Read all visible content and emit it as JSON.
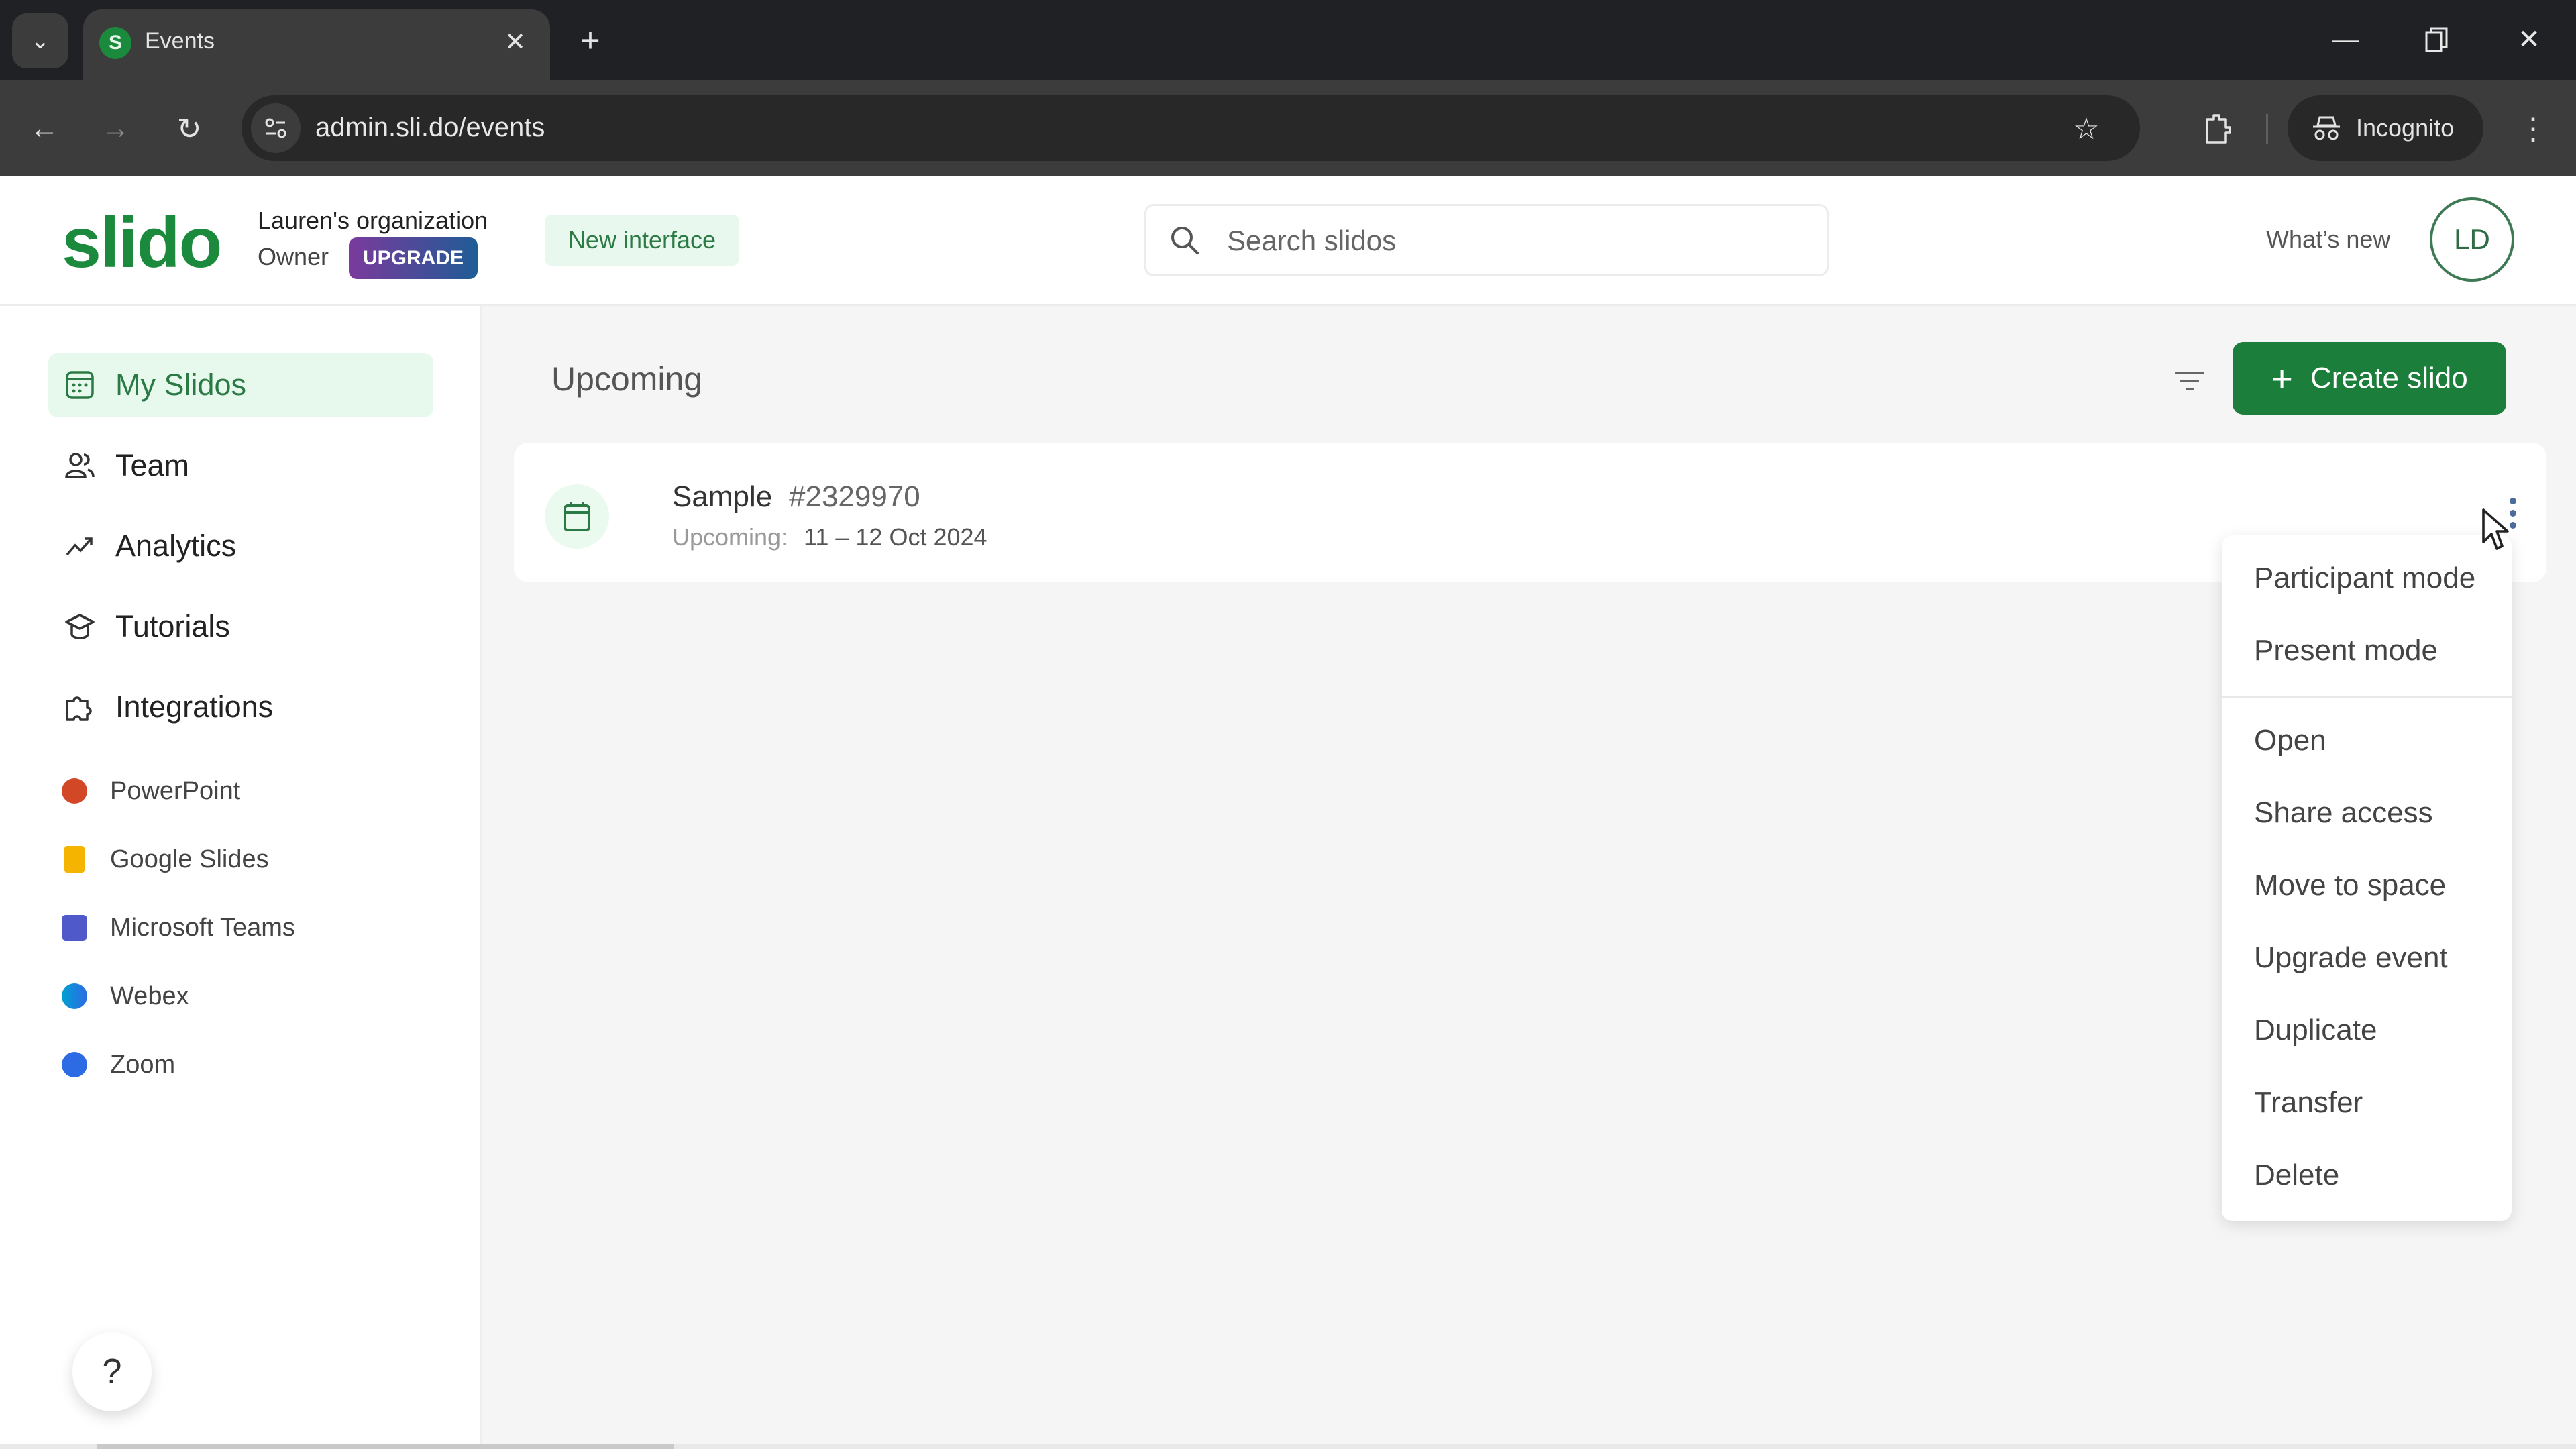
{
  "browser": {
    "tab_title": "Events",
    "tab_favicon_letter": "S",
    "url": "admin.sli.do/events",
    "profile_label": "Incognito",
    "icons": {
      "tab_list": "chevron-down-icon",
      "tab_close": "close-icon",
      "new_tab": "plus-icon",
      "back": "arrow-left-icon",
      "forward": "arrow-right-icon",
      "reload": "reload-icon",
      "site_info": "tune-icon",
      "bookmark": "star-icon",
      "extensions": "puzzle-icon",
      "incognito": "incognito-icon",
      "menu": "kebab-menu-icon",
      "minimize": "minimize-icon",
      "restore": "restore-icon",
      "close": "close-icon"
    }
  },
  "header": {
    "logo": "slido",
    "org_name": "Lauren's organization",
    "role": "Owner",
    "upgrade_label": "UPGRADE",
    "new_interface_label": "New interface",
    "search_placeholder": "Search slidos",
    "whats_new_label": "What’s new",
    "avatar_initials": "LD",
    "colors": {
      "brand": "#1b8a3c",
      "upgrade_from": "#7b3a9c",
      "upgrade_to": "#1f5c95"
    }
  },
  "sidebar": {
    "items": [
      {
        "label": "My Slidos",
        "icon": "calendar-grid-icon",
        "active": true
      },
      {
        "label": "Team",
        "icon": "users-icon",
        "active": false
      },
      {
        "label": "Analytics",
        "icon": "trend-up-icon",
        "active": false
      },
      {
        "label": "Tutorials",
        "icon": "graduation-cap-icon",
        "active": false
      },
      {
        "label": "Integrations",
        "icon": "puzzle-icon",
        "active": false
      }
    ],
    "integrations": [
      {
        "label": "PowerPoint",
        "icon": "powerpoint-icon",
        "color": "#d24726"
      },
      {
        "label": "Google Slides",
        "icon": "google-slides-icon",
        "color": "#f4b400"
      },
      {
        "label": "Microsoft Teams",
        "icon": "microsoft-teams-icon",
        "color": "#5059c9"
      },
      {
        "label": "Webex",
        "icon": "webex-icon",
        "color": "#00a0d1"
      },
      {
        "label": "Zoom",
        "icon": "zoom-icon",
        "color": "#2d6be4"
      }
    ],
    "help_label": "?"
  },
  "main": {
    "section_title": "Upcoming",
    "create_button_label": "Create slido",
    "events": [
      {
        "name": "Sample",
        "code": "#2329970",
        "status_label": "Upcoming:",
        "date_range": "11 – 12 Oct 2024"
      }
    ],
    "context_menu": {
      "items": [
        "Participant mode",
        "Present mode",
        "Open",
        "Share access",
        "Move to space",
        "Upgrade event",
        "Duplicate",
        "Transfer",
        "Delete"
      ]
    }
  }
}
